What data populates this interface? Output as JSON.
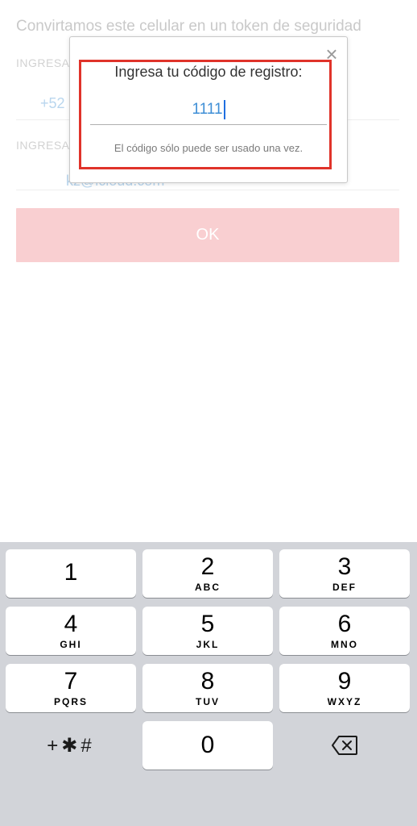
{
  "background": {
    "title": "Convirtamos este celular en un token de seguridad",
    "label1": "INGRESA",
    "value1": "+52",
    "label2": "INGRESA",
    "value2": "kz@icloud.com",
    "ok_label": "OK"
  },
  "dialog": {
    "title": "Ingresa tu código de registro:",
    "code_value": "1111",
    "note": "El código sólo puede ser usado una vez.",
    "close_glyph": "×"
  },
  "keypad": {
    "keys": [
      {
        "digit": "1",
        "letters": ""
      },
      {
        "digit": "2",
        "letters": "ABC"
      },
      {
        "digit": "3",
        "letters": "DEF"
      },
      {
        "digit": "4",
        "letters": "GHI"
      },
      {
        "digit": "5",
        "letters": "JKL"
      },
      {
        "digit": "6",
        "letters": "MNO"
      },
      {
        "digit": "7",
        "letters": "PQRS"
      },
      {
        "digit": "8",
        "letters": "TUV"
      },
      {
        "digit": "9",
        "letters": "WXYZ"
      },
      {
        "digit": "0",
        "letters": ""
      }
    ],
    "symbols_label": "+✱#",
    "delete_icon": "backspace-icon"
  },
  "colors": {
    "accent_red": "#e0332a",
    "ok_button": "#f9cfd1",
    "code_blue": "#3f8fd6",
    "keypad_bg": "#d2d4d9"
  }
}
